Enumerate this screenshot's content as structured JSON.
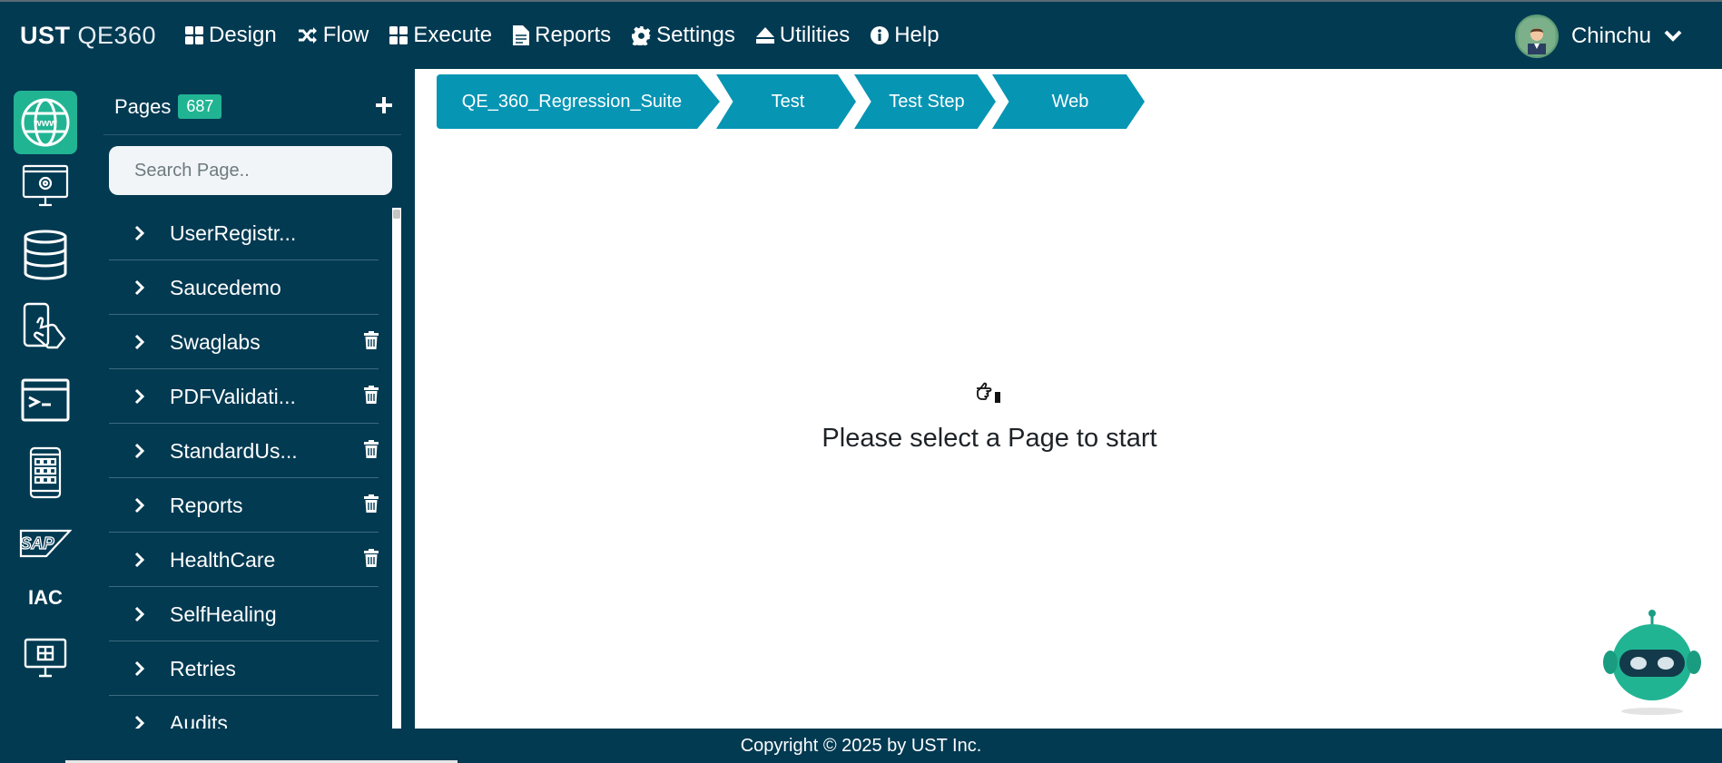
{
  "brand": {
    "bold": "UST",
    "light": "QE360"
  },
  "nav": [
    {
      "label": "Design",
      "icon": "grid-icon"
    },
    {
      "label": "Flow",
      "icon": "shuffle-icon"
    },
    {
      "label": "Execute",
      "icon": "grid-icon"
    },
    {
      "label": "Reports",
      "icon": "document-icon"
    },
    {
      "label": "Settings",
      "icon": "gear-icon"
    },
    {
      "label": "Utilities",
      "icon": "eject-icon"
    },
    {
      "label": "Help",
      "icon": "info-icon"
    }
  ],
  "user": {
    "name": "Chinchu"
  },
  "rail": [
    {
      "name": "web-globe-icon",
      "active": true
    },
    {
      "name": "desktop-settings-icon"
    },
    {
      "name": "database-icon"
    },
    {
      "name": "mobile-touch-icon"
    },
    {
      "name": "terminal-icon"
    },
    {
      "name": "mobile-apps-icon"
    },
    {
      "name": "sap-icon"
    },
    {
      "name": "iac-icon"
    },
    {
      "name": "monitor-windows-icon"
    }
  ],
  "panel": {
    "title": "Pages",
    "count": "687",
    "search_placeholder": "Search Page..",
    "items": [
      {
        "label": "UserRegistr...",
        "deletable": false
      },
      {
        "label": "Saucedemo",
        "deletable": false
      },
      {
        "label": "Swaglabs",
        "deletable": true
      },
      {
        "label": "PDFValidati...",
        "deletable": true
      },
      {
        "label": "StandardUs...",
        "deletable": true
      },
      {
        "label": "Reports",
        "deletable": true
      },
      {
        "label": "HealthCare",
        "deletable": true
      },
      {
        "label": "SelfHealing",
        "deletable": false
      },
      {
        "label": "Retries",
        "deletable": false
      },
      {
        "label": "Audits",
        "deletable": false
      }
    ]
  },
  "breadcrumb": [
    "QE_360_Regression_Suite",
    "Test",
    "Test Step",
    "Web"
  ],
  "main": {
    "empty_message": "Please select a Page to start"
  },
  "footer": {
    "copyright": "Copyright © 2025 by UST Inc."
  },
  "colors": {
    "navy": "#023a52",
    "accent": "#21b493",
    "breadcrumb": "#0795b4"
  }
}
